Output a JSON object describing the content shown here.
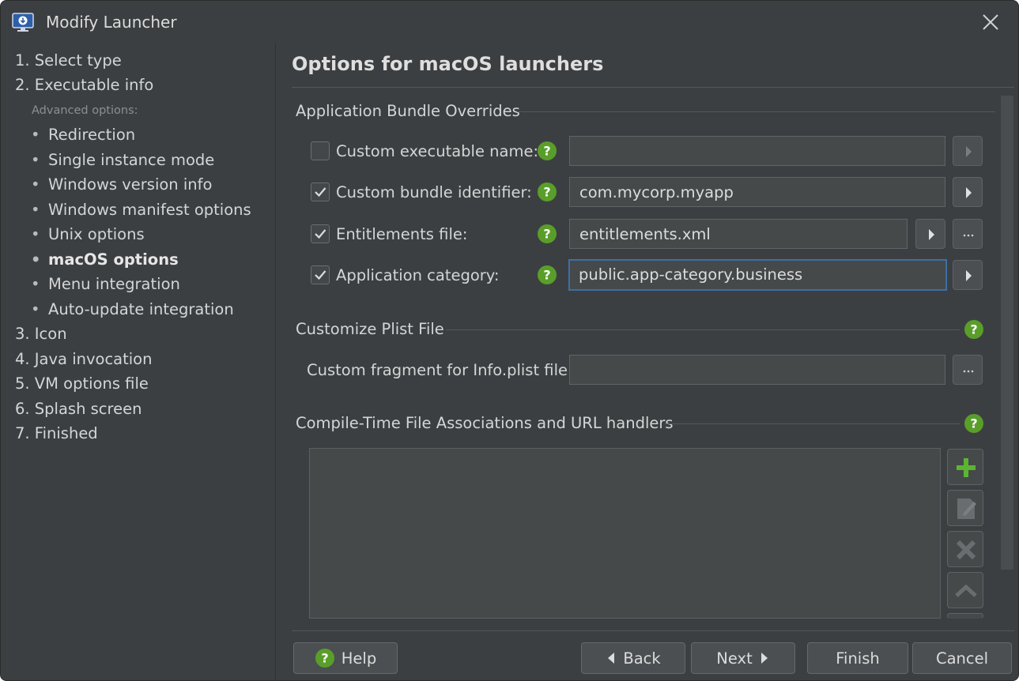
{
  "window": {
    "title": "Modify Launcher",
    "icon": "download-monitor-icon",
    "close_icon": "close-icon"
  },
  "nav": {
    "steps_top": [
      {
        "label": "1. Select type"
      },
      {
        "label": "2. Executable info"
      }
    ],
    "advanced_label": "Advanced options:",
    "sub_items": [
      {
        "label": "Redirection"
      },
      {
        "label": "Single instance mode"
      },
      {
        "label": "Windows version info"
      },
      {
        "label": "Windows manifest options"
      },
      {
        "label": "Unix options"
      },
      {
        "label": "macOS options",
        "active": true
      },
      {
        "label": "Menu integration"
      },
      {
        "label": "Auto-update integration"
      }
    ],
    "bullet": "•",
    "steps_bottom": [
      {
        "label": "3. Icon"
      },
      {
        "label": "4. Java invocation"
      },
      {
        "label": "5. VM options file"
      },
      {
        "label": "6. Splash screen"
      },
      {
        "label": "7. Finished"
      }
    ]
  },
  "main": {
    "title": "Options for macOS launchers",
    "bundle_section": {
      "title": "Application Bundle Overrides",
      "rows": [
        {
          "label": "Custom executable name:",
          "checked": false,
          "value": ""
        },
        {
          "label": "Custom bundle identifier:",
          "checked": true,
          "value": "com.mycorp.myapp"
        },
        {
          "label": "Entitlements file:",
          "checked": true,
          "value": "entitlements.xml"
        },
        {
          "label": "Application category:",
          "checked": true,
          "value": "public.app-category.business"
        }
      ],
      "browse_label": "..."
    },
    "plist_section": {
      "title": "Customize Plist File",
      "field_label": "Custom fragment for Info.plist file:",
      "field_value": "",
      "browse_label": "..."
    },
    "assoc_section": {
      "title": "Compile-Time File Associations and URL handlers",
      "buttons": [
        "add-icon",
        "edit-icon",
        "delete-icon",
        "move-up-icon"
      ]
    }
  },
  "footer": {
    "help": "Help",
    "back": "Back",
    "next": "Next",
    "finish": "Finish",
    "cancel": "Cancel"
  },
  "colors": {
    "background": "#3c3f41",
    "field": "#45494a",
    "focus_border": "#3d6fa6",
    "help_green": "#5a9e2a",
    "add_green": "#5cb531"
  }
}
